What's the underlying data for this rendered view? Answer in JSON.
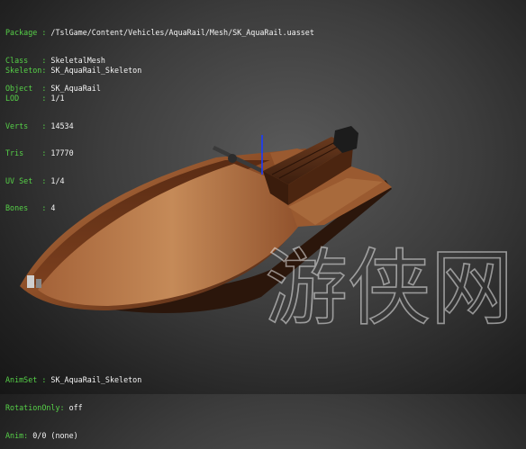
{
  "mesh_info": {
    "package": {
      "key": "Package : ",
      "value": "/TslGame/Content/Vehicles/AquaRail/Mesh/SK_AquaRail.uasset"
    },
    "class": {
      "key": "Class   : ",
      "value": "SkeletalMesh"
    },
    "object": {
      "key": "Object  : ",
      "value": "SK_AquaRail"
    }
  },
  "skeleton_info": {
    "skeleton": {
      "key": "Skeleton: ",
      "value": "SK_AquaRail_Skeleton"
    },
    "lod": {
      "key": "LOD     : ",
      "value": "1/1"
    },
    "verts": {
      "key": "Verts   : ",
      "value": "14534"
    },
    "tris": {
      "key": "Tris    : ",
      "value": "17770"
    },
    "uvset": {
      "key": "UV Set  : ",
      "value": "1/4"
    },
    "bones": {
      "key": "Bones   : ",
      "value": "4"
    }
  },
  "anim_info": {
    "animset": {
      "key": "AnimSet : ",
      "value": "SK_AquaRail_Skeleton"
    },
    "rotationonly": {
      "key": "RotationOnly: ",
      "value": "off"
    },
    "anim": {
      "key": "Anim: ",
      "value": "0/0 (none)"
    }
  },
  "viewport": {
    "model": "aquarail-model",
    "axis_color": "#1a3cff",
    "hull_color": "#8a4a26"
  },
  "watermark": {
    "text": "游侠网",
    "icon": "watermark-logo"
  }
}
